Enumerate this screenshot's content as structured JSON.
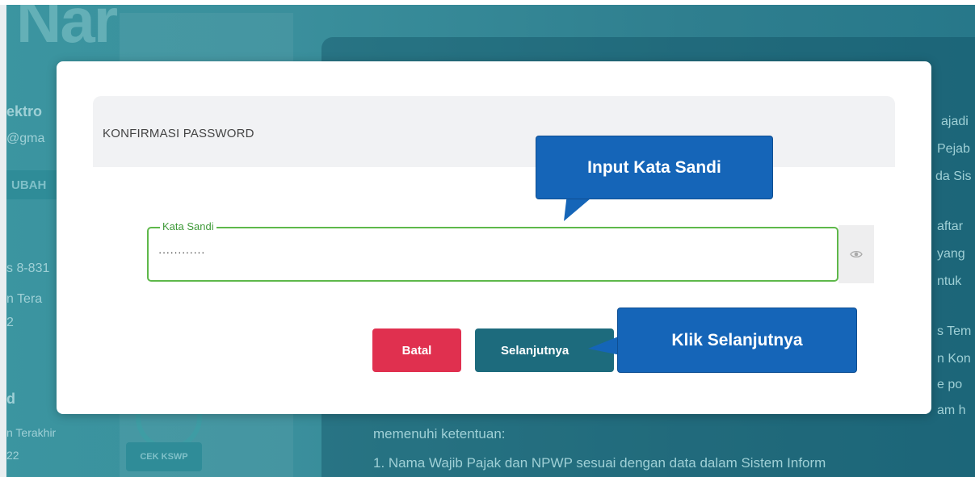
{
  "background": {
    "logo_text": "Nar",
    "left_texts": [
      "ektro",
      "@gma",
      "UBAH",
      "s 8-831",
      "n Tera",
      "2",
      "d",
      "n Terakhir",
      "22"
    ],
    "check_button": "CEK KSWP",
    "right_texts": [
      "ajadi",
      "Pejab",
      "da Sis",
      "aftar",
      "yang",
      "ntuk",
      "s Tem",
      "n Kon",
      "e po",
      "am h"
    ],
    "bottom_lines": [
      "memenuhi ketentuan:",
      "1. Nama Wajib Pajak dan NPWP sesuai dengan data dalam Sistem Inform"
    ]
  },
  "modal": {
    "title": "KONFIRMASI PASSWORD",
    "password_field": {
      "label": "Kata Sandi",
      "value": "············"
    },
    "buttons": {
      "cancel": "Batal",
      "next": "Selanjutnya"
    }
  },
  "annotations": {
    "input_callout": "Input Kata Sandi",
    "next_callout": "Klik Selanjutnya"
  },
  "colors": {
    "accent_teal": "#1d6b7d",
    "cancel_red": "#e0304f",
    "field_green": "#5eb84a",
    "callout_blue": "#1565b8"
  },
  "icons": {
    "password_toggle": "eye-icon"
  }
}
